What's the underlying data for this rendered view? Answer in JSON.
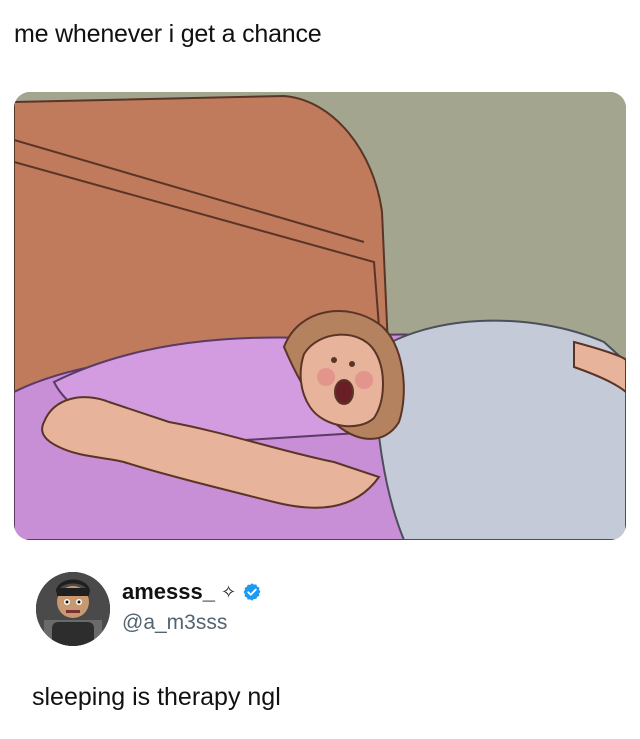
{
  "caption": "me whenever i get a chance",
  "image": {
    "description_icon": "sleeping-woman-meme-image",
    "colors": {
      "wall": "#a3a58f",
      "headboard": "#c07a5c",
      "blanket": "#c98fd6",
      "shirt": "#c4cad7",
      "skin": "#e7b39a",
      "hair": "#b58260"
    }
  },
  "post": {
    "display_name": "amesss_",
    "sparkle_icon": "✧",
    "verified_icon": "verified-badge-icon",
    "handle": "@a_m3sss",
    "text": "sleeping is therapy ngl",
    "accent_color": "#1d9bf0"
  }
}
